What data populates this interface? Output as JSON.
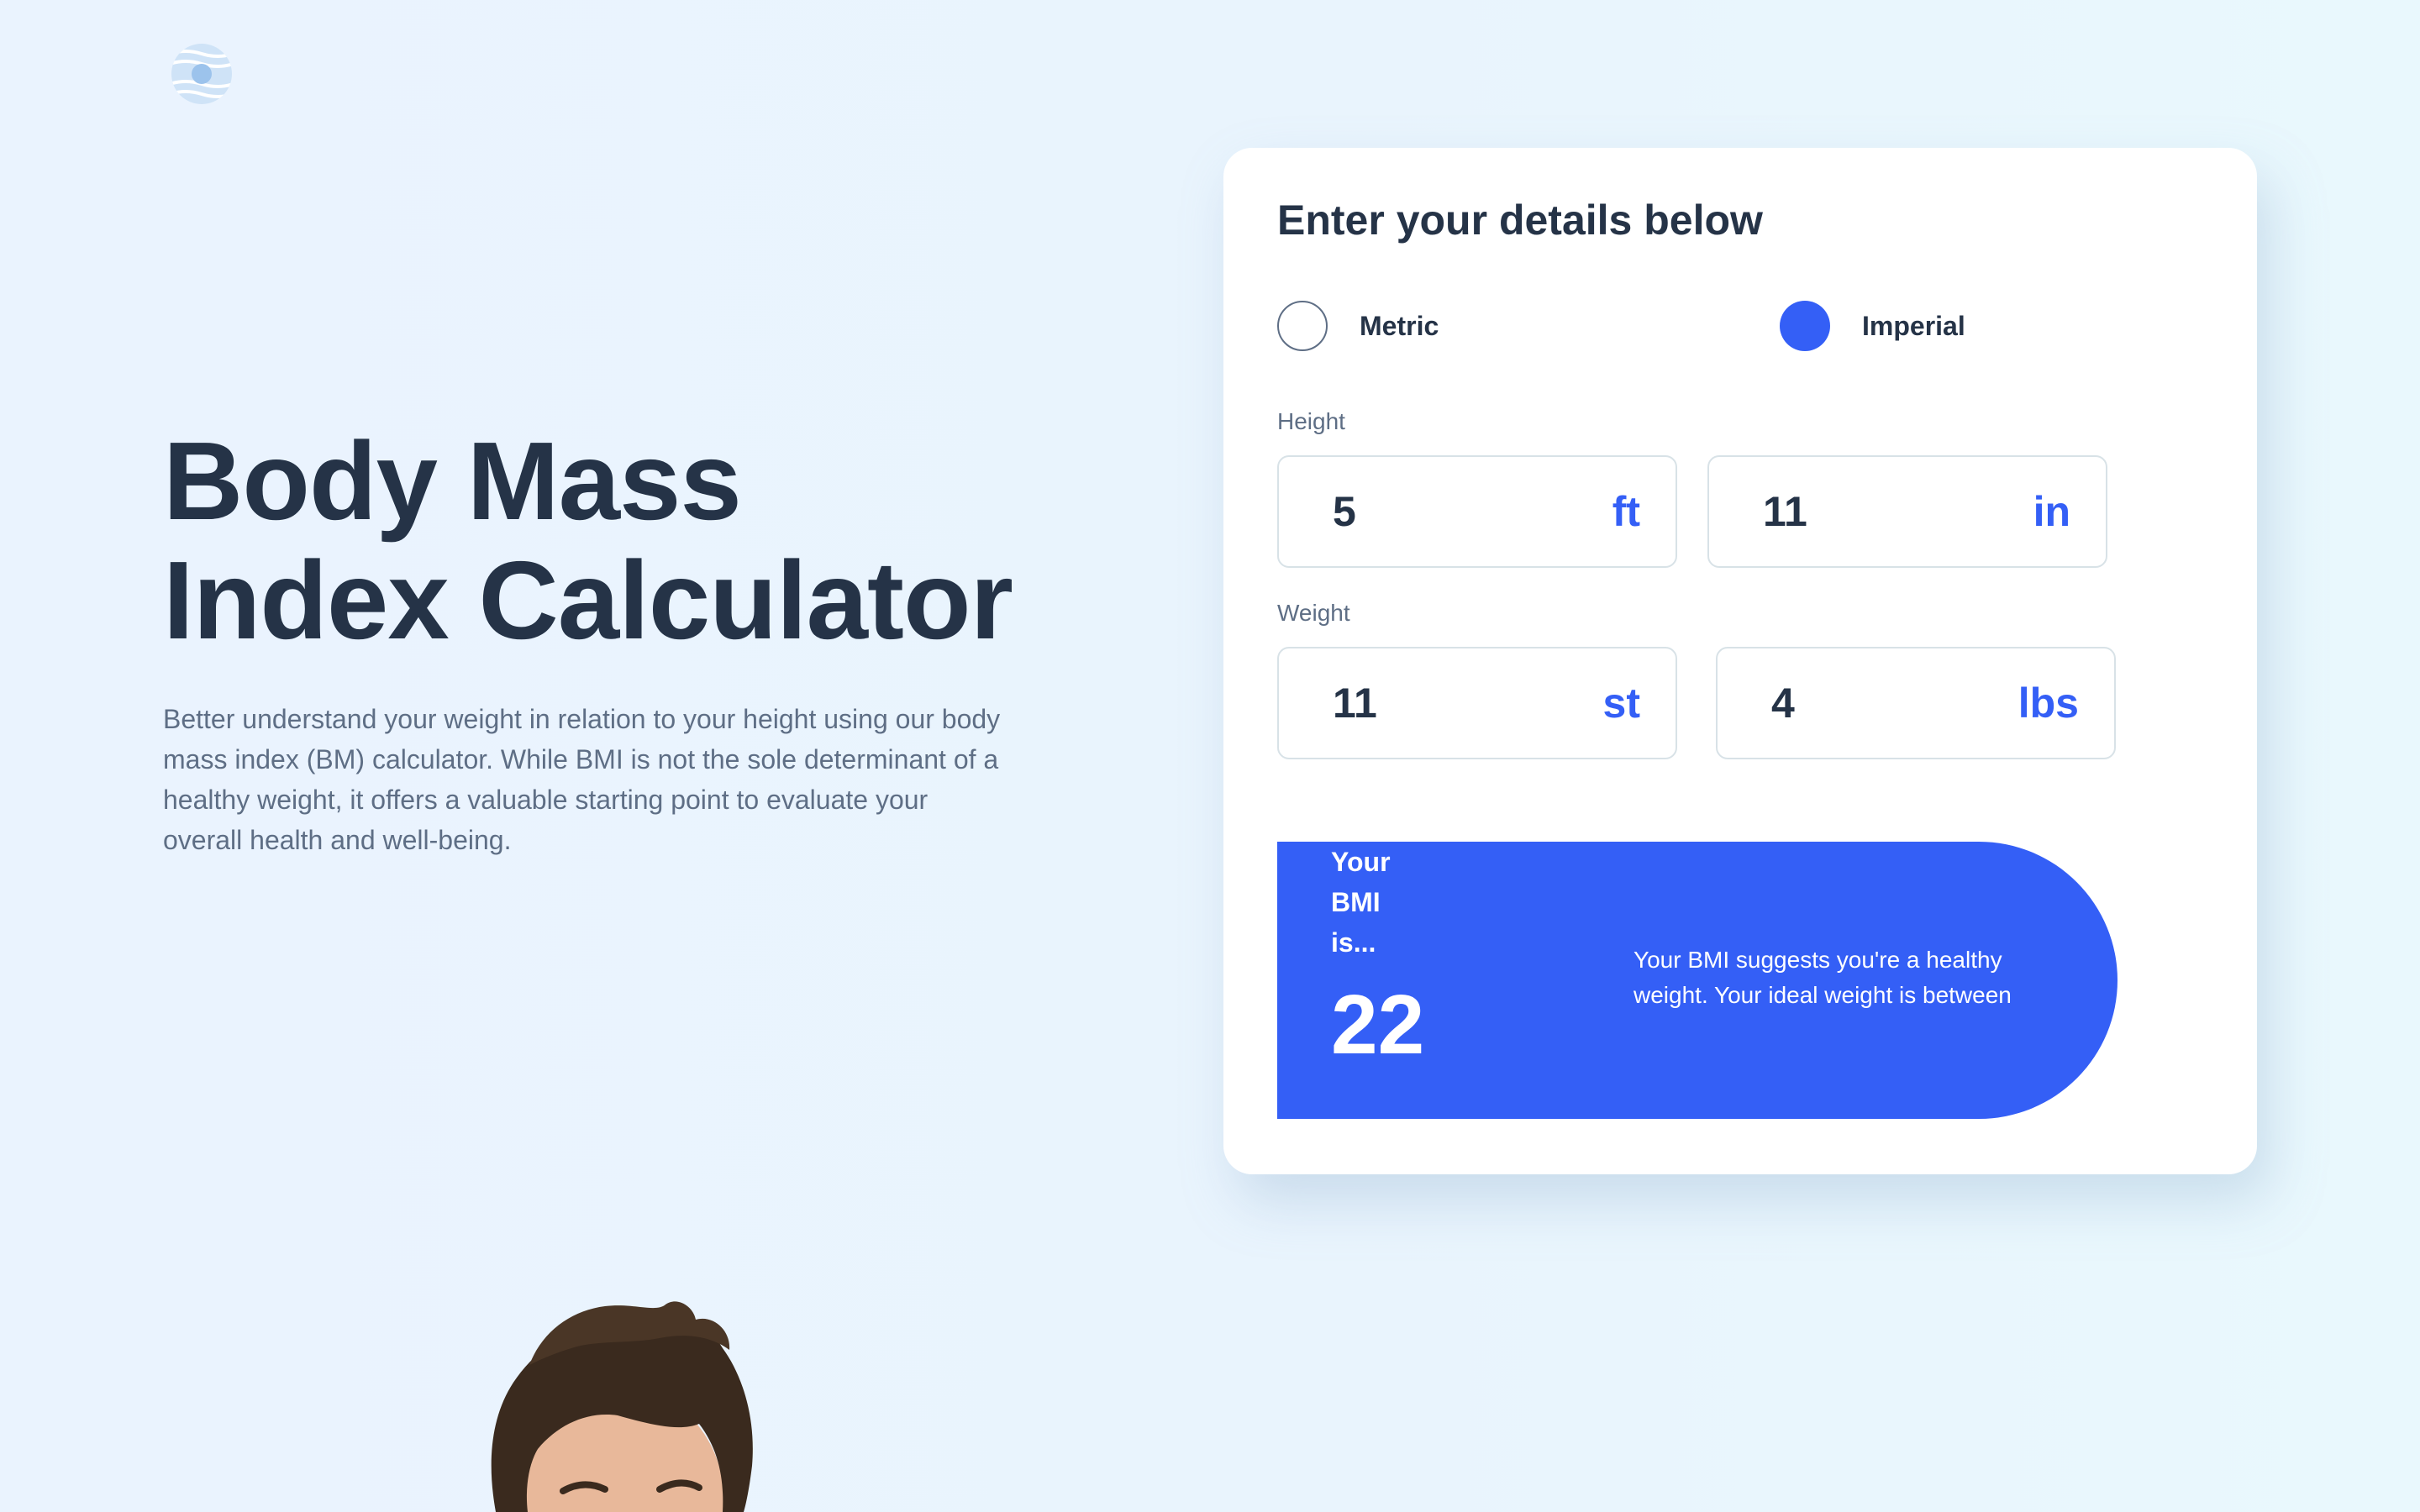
{
  "logo": {
    "icon": "striped-globe-logo-icon",
    "color": "#345ff6"
  },
  "hero": {
    "title_line1": "Body Mass",
    "title_line2": "Index Calculator",
    "description": "Better understand your weight in relation to your height using our body mass index (BM) calculator. While BMI is not the sole determinant of a healthy weight, it offers a valuable starting point to evaluate your overall health and well-being."
  },
  "calculator": {
    "title": "Enter your details below",
    "units": [
      {
        "label": "Metric",
        "selected": false
      },
      {
        "label": "Imperial",
        "selected": true
      }
    ],
    "height": {
      "label": "Height",
      "feet": {
        "value": "5",
        "unit": "ft"
      },
      "inches": {
        "value": "11",
        "unit": "in"
      }
    },
    "weight": {
      "label": "Weight",
      "stone": {
        "value": "11",
        "unit": "st"
      },
      "pounds": {
        "value": "4",
        "unit": "lbs"
      }
    },
    "result": {
      "heading": "Your BMI is...",
      "value": "22",
      "description": "Your BMI suggests you're a healthy weight. Your ideal weight is between"
    }
  },
  "colors": {
    "primary": "#345ff6",
    "heading": "#253347",
    "body_text": "#5e6e85",
    "input_border": "#d8e2e7",
    "card": "#ffffff",
    "background": "#e9f4fd"
  }
}
